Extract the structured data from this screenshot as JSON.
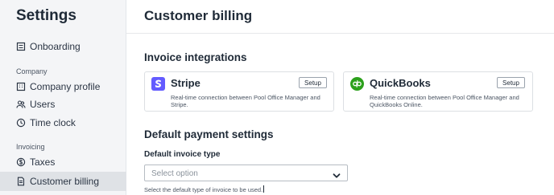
{
  "sidebar": {
    "title": "Settings",
    "items": [
      {
        "label": "Onboarding"
      },
      {
        "label": "Company profile"
      },
      {
        "label": "Users"
      },
      {
        "label": "Time clock"
      },
      {
        "label": "Taxes"
      },
      {
        "label": "Customer billing",
        "active": true
      }
    ],
    "sections": {
      "company": "Company",
      "invoicing": "Invoicing"
    }
  },
  "page": {
    "title": "Customer billing"
  },
  "integrations": {
    "heading": "Invoice integrations",
    "cards": [
      {
        "name": "Stripe",
        "description": "Real-time connection between Pool Office Manager and Stripe.",
        "button": "Setup",
        "logo_color": "#635bff",
        "logo_icon": "stripe-logo-icon"
      },
      {
        "name": "QuickBooks",
        "description": "Real-time connection between Pool Office Manager and QuickBooks Online.",
        "button": "Setup",
        "logo_color": "#2ca01c",
        "logo_icon": "quickbooks-logo-icon"
      }
    ]
  },
  "payment_settings": {
    "heading": "Default payment settings",
    "invoice_type_label": "Default invoice type",
    "invoice_type_value": "Select option",
    "help_text": "Select the default type of invoice to be used."
  }
}
